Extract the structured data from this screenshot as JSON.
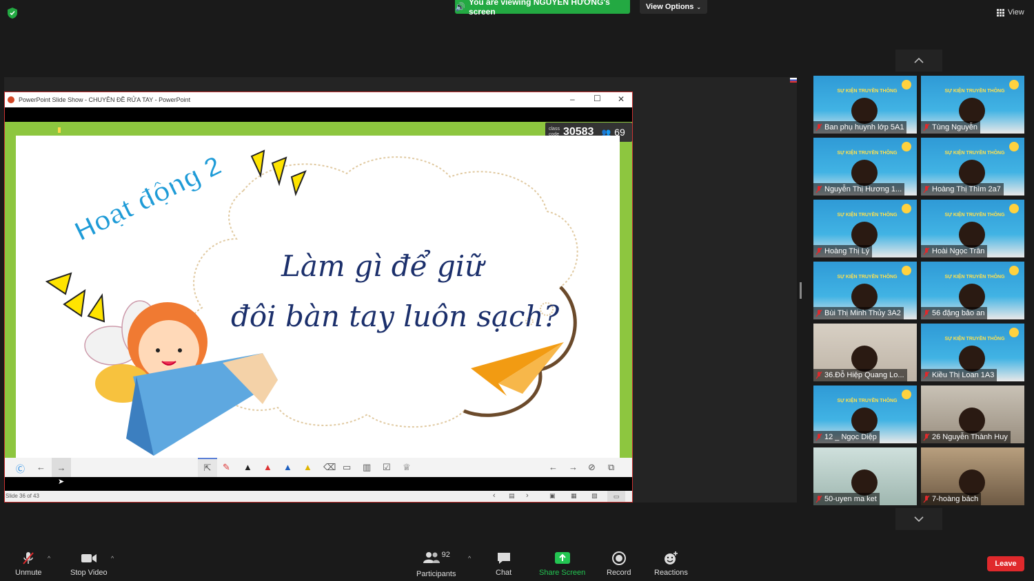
{
  "top": {
    "banner": "You are viewing NGUYỄN HƯƠNG's screen",
    "view_options": "View Options",
    "view": "View"
  },
  "ppt": {
    "title": "PowerPoint Slide Show  -  CHUYÊN ĐỀ RỬA TAY - PowerPoint",
    "class_small_1": "class",
    "class_small_2": "code",
    "class_code": "30583",
    "participants_count": "69",
    "slide_heading": "Hoạt động 2",
    "slide_line1": "Làm gì để giữ",
    "slide_line2": "đôi bàn tay luôn sạch?",
    "status": "Slide 36 of 43"
  },
  "thumb_header": "SỰ KIỆN TRUYỀN THÔNG",
  "participants": [
    {
      "name": "Ban phụ huynh lớp 5A1",
      "style": "slide"
    },
    {
      "name": "Tùng Nguyễn",
      "style": "slide"
    },
    {
      "name": "Nguyễn Thị Hương 1...",
      "style": "slide"
    },
    {
      "name": "Hoàng Thị Thìm 2a7",
      "style": "slide"
    },
    {
      "name": "Hoàng Thị Lý",
      "style": "slide"
    },
    {
      "name": "Hoài Ngọc Trân",
      "style": "slide"
    },
    {
      "name": "Bùi Thị Minh Thủy 3A2",
      "style": "slide"
    },
    {
      "name": "56 đặng  bảo an",
      "style": "slide"
    },
    {
      "name": "36.Đỗ Hiệp Quang Lo...",
      "style": "room"
    },
    {
      "name": "Kiều Thị Loan 1A3",
      "style": "slide"
    },
    {
      "name": "12 _ Ngọc Diệp",
      "style": "slide"
    },
    {
      "name": "26 Nguyễn Thành Huy",
      "style": "room2"
    },
    {
      "name": "50-uyen ma ket",
      "style": "room3"
    },
    {
      "name": "7-hoàng bách",
      "style": "room4"
    }
  ],
  "controls": {
    "unmute": "Unmute",
    "stop_video": "Stop Video",
    "participants": "Participants",
    "participants_count": "92",
    "chat": "Chat",
    "share_screen": "Share Screen",
    "record": "Record",
    "reactions": "Reactions",
    "leave": "Leave"
  },
  "colors": {
    "banner_green": "#23a942",
    "slide_green": "#8dc63f",
    "leave_red": "#e0292c",
    "mic_muted_red": "#e0292c"
  }
}
